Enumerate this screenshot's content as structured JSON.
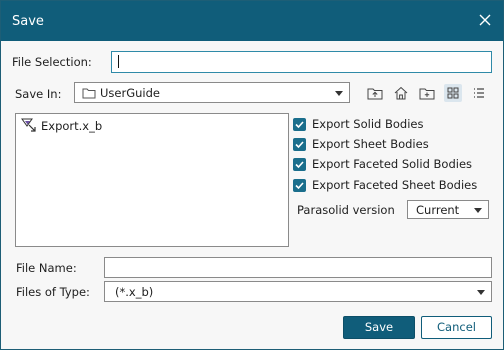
{
  "window": {
    "title": "Save",
    "close_icon": "close-icon"
  },
  "file_selection": {
    "label": "File Selection:",
    "value": ""
  },
  "save_in": {
    "label": "Save In:",
    "folder": "UserGuide",
    "toolbar_icons": [
      "up-folder-icon",
      "home-icon",
      "new-folder-icon",
      "grid-view-icon",
      "list-view-icon"
    ]
  },
  "file_list": {
    "items": [
      {
        "name": "Export.x_b",
        "icon": "parasolid-file-icon"
      }
    ]
  },
  "options": {
    "checkboxes": [
      {
        "label": "Export Solid Bodies",
        "checked": true
      },
      {
        "label": "Export Sheet Bodies",
        "checked": true
      },
      {
        "label": "Export Faceted Solid Bodies",
        "checked": true
      },
      {
        "label": "Export Faceted Sheet Bodies",
        "checked": true
      }
    ],
    "version_label": "Parasolid version",
    "version_value": "Current"
  },
  "file_name": {
    "label": "File Name:",
    "value": ""
  },
  "file_type": {
    "label": "Files of Type:",
    "value": "(*.x_b)"
  },
  "buttons": {
    "save": "Save",
    "cancel": "Cancel"
  },
  "colors": {
    "accent": "#105d7a",
    "checkbox": "#1a6e8c",
    "focus_border": "#2f8aa8"
  }
}
